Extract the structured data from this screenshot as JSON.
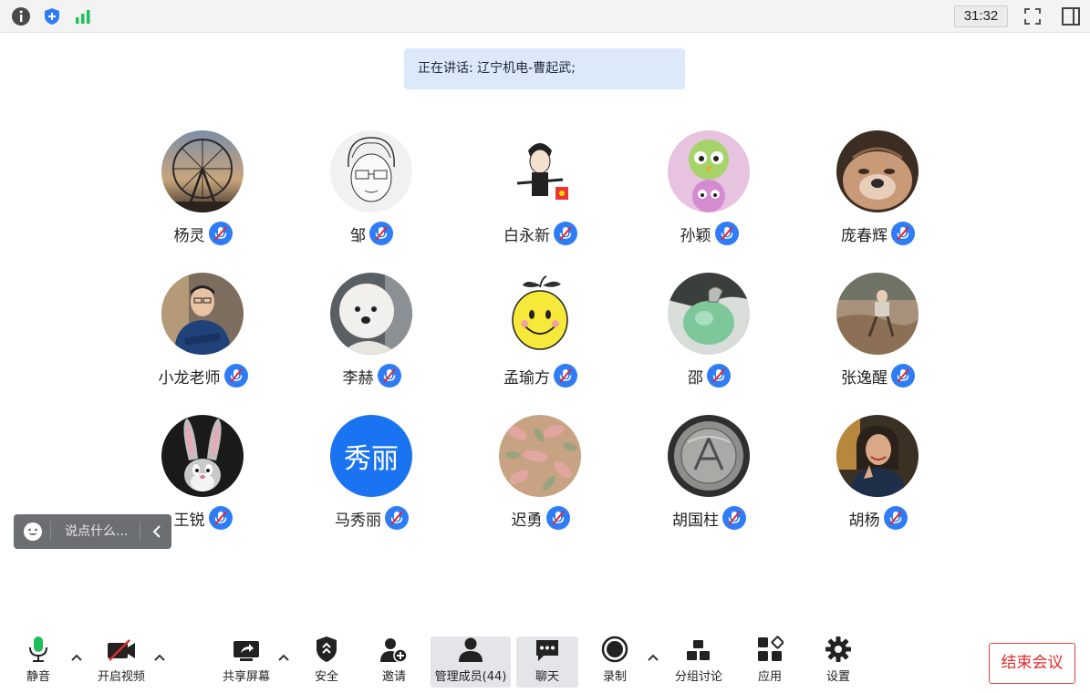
{
  "top_bar": {
    "timer": "31:32",
    "icons": [
      "info-icon",
      "shield-icon",
      "signal-icon",
      "fullscreen-icon",
      "side-panel-icon"
    ]
  },
  "speaker_banner": "正在讲话: 辽宁机电-曹起武;",
  "participants": [
    {
      "name": "杨灵",
      "avatar": "ferris-wheel-photo"
    },
    {
      "name": "邹",
      "avatar": "sketch-portrait"
    },
    {
      "name": "白永新",
      "avatar": "cartoon-man"
    },
    {
      "name": "孙颖",
      "avatar": "cartoon-birds"
    },
    {
      "name": "庞春辉",
      "avatar": "bulldog-photo"
    },
    {
      "name": "小龙老师",
      "avatar": "man-portrait"
    },
    {
      "name": "李赫",
      "avatar": "white-dog-photo"
    },
    {
      "name": "孟瑜方",
      "avatar": "smiley-lemon"
    },
    {
      "name": "邵",
      "avatar": "jade-pendant"
    },
    {
      "name": "张逸醒",
      "avatar": "field-photo"
    },
    {
      "name": "王锐",
      "avatar": "bugs-bunny"
    },
    {
      "name": "马秀丽",
      "avatar": "text-avatar",
      "avatar_text": "秀丽"
    },
    {
      "name": "迟勇",
      "avatar": "autumn-leaves"
    },
    {
      "name": "胡国柱",
      "avatar": "coin-photo"
    },
    {
      "name": "胡杨",
      "avatar": "woman-photo"
    }
  ],
  "chat_input": {
    "placeholder": "说点什么..."
  },
  "toolbar": {
    "mute": "静音",
    "video": "开启视频",
    "share": "共享屏幕",
    "security": "安全",
    "invite": "邀请",
    "members": "管理成员(44)",
    "chat": "聊天",
    "record": "录制",
    "breakout": "分组讨论",
    "apps": "应用",
    "settings": "设置"
  },
  "end_meeting": "结束会议",
  "colors": {
    "accent": "#2f7df6",
    "mic_green": "#1fbf5a",
    "end_red": "#e02929"
  }
}
